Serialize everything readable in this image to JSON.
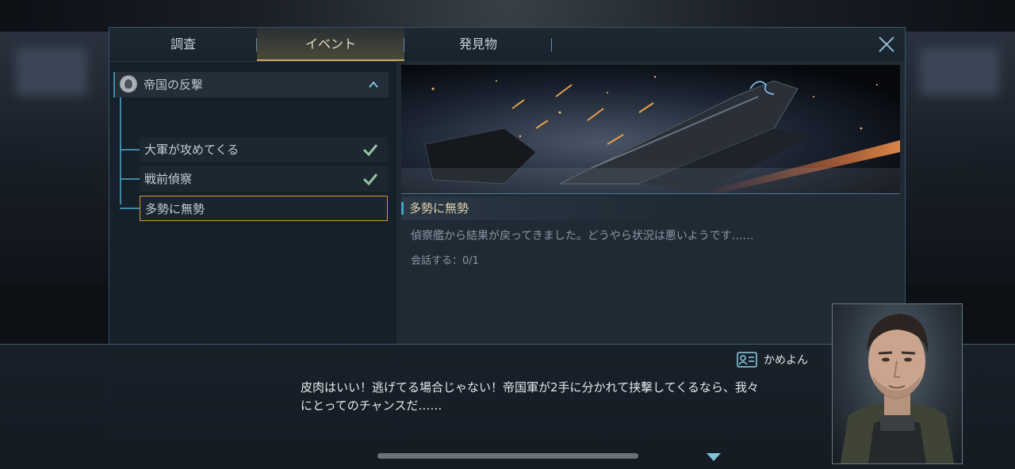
{
  "tabs": [
    {
      "label": "調査"
    },
    {
      "label": "イベント"
    },
    {
      "label": "発見物"
    }
  ],
  "active_tab": "イベント",
  "quest_group": {
    "title": "帝国の反撃",
    "items": [
      {
        "label": "大軍が攻めてくる",
        "completed": true
      },
      {
        "label": "戦前偵察",
        "completed": true
      },
      {
        "label": "多勢に無勢",
        "completed": false,
        "selected": true
      }
    ]
  },
  "detail": {
    "title": "多勢に無勢",
    "description": "偵察艦から結果が戻ってきました。どうやら状況は悪いようです……",
    "progress": "会話する：0/1"
  },
  "dialog": {
    "speaker": "かめよん",
    "line1": "皮肉はいい！逃げてる場合じゃない！帝国軍が2手に分かれて挟撃してくるなら、我々",
    "line2": "にとってのチャンスだ……"
  },
  "colors": {
    "accent_gold": "#c99a3c",
    "accent_blue": "#3f89a6",
    "check_green": "#8fc7a0"
  },
  "icons": {
    "close": "close-icon",
    "collapse": "chevron-up-icon",
    "check": "check-icon",
    "speaker": "id-card-icon",
    "next": "triangle-down-icon"
  }
}
